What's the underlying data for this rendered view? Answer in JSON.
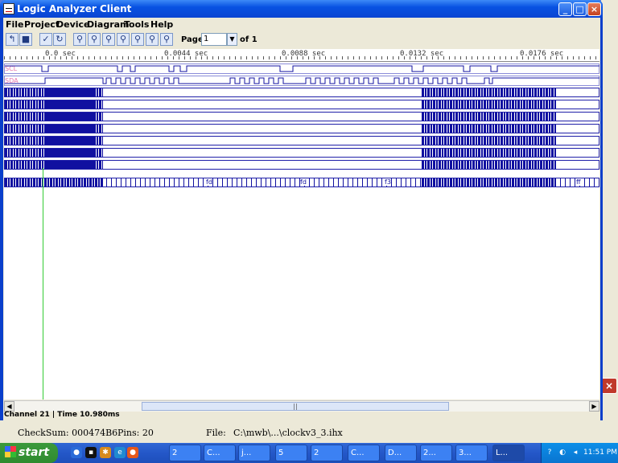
{
  "window": {
    "title": "Logic Analyzer Client"
  },
  "menu": [
    "File",
    "Project",
    "Device",
    "Diagram",
    "Tools",
    "Help"
  ],
  "toolbar": {
    "page_label": "Page",
    "page_value": "1",
    "page_of": "of 1"
  },
  "ruler_ticks": [
    "0.0 sec",
    "0.0044 sec",
    "0.0088 sec",
    "0.0132 sec",
    "0.0176 sec"
  ],
  "signals": [
    "SCL",
    "SDA"
  ],
  "bus_labels": [
    "fd",
    "fd",
    "f3",
    "ff"
  ],
  "status": "Channel 21 | Time 10.980ms",
  "background_window": {
    "checksum": "CheckSum: 000474B6",
    "pins": "Pins:   20",
    "file_label": "File:",
    "file_path": "C:\\mwb\\...\\clockv3_3.ihx"
  },
  "taskbar": {
    "start": "start",
    "tasks": [
      "2",
      "C...",
      "j...",
      "5",
      "2",
      "C...",
      "D...",
      "2...",
      "3...",
      "L..."
    ],
    "clock": "11:51 PM"
  },
  "colors": {
    "signal": "#1010a0",
    "label": "#e67ab0",
    "cursor": "#33cc33"
  }
}
